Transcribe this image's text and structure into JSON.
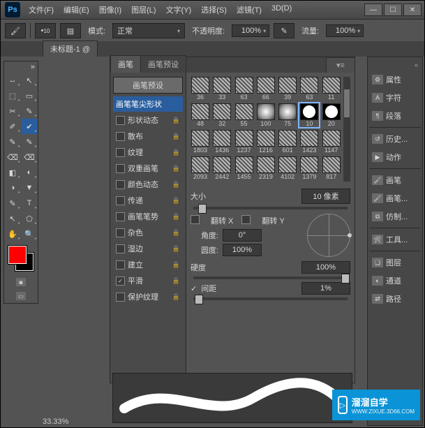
{
  "menu": {
    "file": "文件(F)",
    "edit": "编辑(E)",
    "image": "图像(I)",
    "layer": "图层(L)",
    "type": "文字(Y)",
    "select": "选择(S)",
    "filter": "滤镜(T)",
    "threeD": "3D(D)"
  },
  "win_controls": {
    "min": "—",
    "max": "☐",
    "close": "✕"
  },
  "optbar": {
    "brush_size": "10",
    "mode_label": "模式:",
    "mode_value": "正常",
    "opacity_label": "不透明度:",
    "opacity_value": "100%",
    "flow_label": "流量:",
    "flow_value": "100%"
  },
  "doc": {
    "tab": "未标题-1 @",
    "zoom": "33.33%"
  },
  "tools": [
    [
      "↔",
      "↖"
    ],
    [
      "⬚",
      "▭"
    ],
    [
      "✂",
      "✎"
    ],
    [
      "✐",
      "✔"
    ],
    [
      "✎",
      "✎"
    ],
    [
      "⌫",
      "⌫"
    ],
    [
      "◧",
      "◐"
    ],
    [
      "◑",
      "▼"
    ],
    [
      "✎",
      "T"
    ],
    [
      "↖",
      "⬠"
    ],
    [
      "✋",
      "🔍"
    ]
  ],
  "brush_panel": {
    "tab_brush": "画笔",
    "tab_presets": "画笔预设",
    "preset_button": "画笔预设",
    "sections": [
      {
        "label": "画笔笔尖形状",
        "cb": null,
        "lock": false,
        "selected": true
      },
      {
        "label": "形状动态",
        "cb": false,
        "lock": true
      },
      {
        "label": "散布",
        "cb": false,
        "lock": true
      },
      {
        "label": "纹理",
        "cb": false,
        "lock": true
      },
      {
        "label": "双重画笔",
        "cb": false,
        "lock": true
      },
      {
        "label": "颜色动态",
        "cb": false,
        "lock": true
      },
      {
        "label": "传递",
        "cb": false,
        "lock": true
      },
      {
        "label": "画笔笔势",
        "cb": false,
        "lock": true
      },
      {
        "label": "杂色",
        "cb": false,
        "lock": true
      },
      {
        "label": "湿边",
        "cb": false,
        "lock": true
      },
      {
        "label": "建立",
        "cb": false,
        "lock": true
      },
      {
        "label": "平滑",
        "cb": true,
        "lock": true
      },
      {
        "label": "保护纹理",
        "cb": false,
        "lock": true
      }
    ],
    "presets": [
      {
        "v": "36",
        "t": "tex"
      },
      {
        "v": "33",
        "t": "tex"
      },
      {
        "v": "63",
        "t": "tex"
      },
      {
        "v": "66",
        "t": "tex"
      },
      {
        "v": "39",
        "t": "tex"
      },
      {
        "v": "63",
        "t": "tex"
      },
      {
        "v": "11",
        "t": "tex"
      },
      {
        "v": "48",
        "t": "tex"
      },
      {
        "v": "32",
        "t": "tex"
      },
      {
        "v": "55",
        "t": "tex"
      },
      {
        "v": "100",
        "t": "soft"
      },
      {
        "v": "75",
        "t": "soft"
      },
      {
        "v": "10",
        "t": "hard",
        "sel": true
      },
      {
        "v": "20",
        "t": "hard"
      },
      {
        "v": "1803",
        "t": "tex"
      },
      {
        "v": "1436",
        "t": "tex"
      },
      {
        "v": "1237",
        "t": "tex"
      },
      {
        "v": "1216",
        "t": "tex"
      },
      {
        "v": "601",
        "t": "tex"
      },
      {
        "v": "1423",
        "t": "tex"
      },
      {
        "v": "1147",
        "t": "tex"
      },
      {
        "v": "2093",
        "t": "tex"
      },
      {
        "v": "2442",
        "t": "tex"
      },
      {
        "v": "1455",
        "t": "tex"
      },
      {
        "v": "2319",
        "t": "tex"
      },
      {
        "v": "4102",
        "t": "tex"
      },
      {
        "v": "1379",
        "t": "tex"
      },
      {
        "v": "817",
        "t": "tex"
      }
    ],
    "size_label": "大小",
    "size_value": "10 像素",
    "flipx": "翻转 X",
    "flipy": "翻转 Y",
    "angle_label": "角度:",
    "angle_value": "0°",
    "roundness_label": "圆度:",
    "roundness_value": "100%",
    "hardness_label": "硬度",
    "hardness_value": "100%",
    "spacing_label": "间距",
    "spacing_value": "1%",
    "spacing_checked": true
  },
  "right_panels": [
    {
      "icon": "⚙",
      "label": "属性"
    },
    {
      "icon": "A",
      "label": "字符"
    },
    {
      "icon": "¶",
      "label": "段落"
    },
    {
      "sep": true
    },
    {
      "icon": "↺",
      "label": "历史..."
    },
    {
      "icon": "▶",
      "label": "动作"
    },
    {
      "sep": true
    },
    {
      "icon": "🖌",
      "label": "画笔"
    },
    {
      "icon": "🖌",
      "label": "画笔..."
    },
    {
      "icon": "⧉",
      "label": "仿制..."
    },
    {
      "sep": true
    },
    {
      "icon": "🛠",
      "label": "工具..."
    },
    {
      "sep": true
    },
    {
      "icon": "❏",
      "label": "图层"
    },
    {
      "icon": "◐",
      "label": "通道"
    },
    {
      "icon": "⇄",
      "label": "路径"
    }
  ],
  "watermark": {
    "title": "溜溜自学",
    "sub": "WWW.ZIXUE.3D66.COM"
  }
}
